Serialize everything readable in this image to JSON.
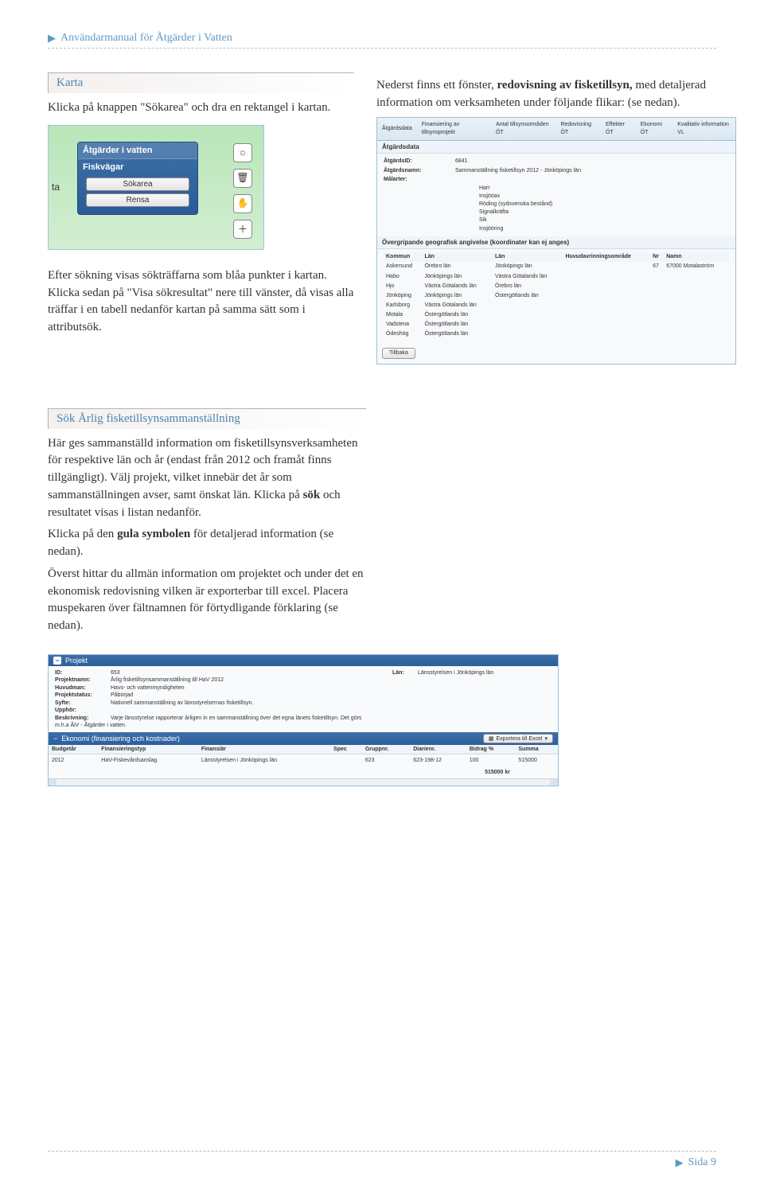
{
  "header": {
    "title": "Användarmanual för Åtgärder i Vatten"
  },
  "section1": {
    "heading": "Karta",
    "para": "Klicka på knappen \"Sökarea\" och dra en rektangel i kartan."
  },
  "map_popup": {
    "title": "Åtgärder i vatten",
    "subtitle": "Fiskvägar",
    "btn1": "Sökarea",
    "btn2": "Rensa"
  },
  "right1": {
    "p1a": "Nederst finns ett fönster, ",
    "p1b": "redovisning av fisketillsyn,",
    "p1c": " med detaljerad information om verksamheten under följande flikar: (se nedan)."
  },
  "atgards": {
    "tabs": [
      "Åtgärdsdata",
      "Finansiering av tillsynsprojekt",
      "Antal tillsynsområden ÖT",
      "Redovisning ÖT",
      "Effekter ÖT",
      "Ekonomi ÖT",
      "Kvalitativ information VL"
    ],
    "heading": "Åtgärdsdata",
    "id_label": "ÅtgärdsID:",
    "id_value": "6841",
    "name_label": "Åtgärdsnamn:",
    "name_value": "Sammanställning fisketillsyn 2012 - Jönköpings län",
    "malarter_label": "Målarter:",
    "malarter": [
      "Harr",
      "Insjööax",
      "Röding (sydsvenska bestånd)",
      "Signalkräfta",
      "Sik",
      "Insjööring"
    ],
    "geo_heading": "Övergripande geografisk angivelse (koordinater kan ej anges)",
    "cols": [
      "Kommun",
      "Län",
      "Län",
      "Huvudavrinningsområde",
      "Nr",
      "Namn"
    ],
    "rows": [
      [
        "Askersund",
        "Örebro län",
        "Jönköpings län",
        "",
        "67",
        "67000 Motalaström"
      ],
      [
        "Habo",
        "Jönköpings län",
        "Västra Götalands län",
        "",
        "",
        ""
      ],
      [
        "Hjo",
        "Västra Götalands län",
        "Örebro län",
        "",
        "",
        ""
      ],
      [
        "Jönköping",
        "Jönköpings län",
        "Östergötlands län",
        "",
        "",
        ""
      ],
      [
        "Karlsborg",
        "Västra Götalands län",
        "",
        "",
        "",
        ""
      ],
      [
        "Motala",
        "Östergötlands län",
        "",
        "",
        "",
        ""
      ],
      [
        "Vadstena",
        "Östergötlands län",
        "",
        "",
        "",
        ""
      ],
      [
        "Ödeshög",
        "Östergötlands län",
        "",
        "",
        "",
        ""
      ]
    ],
    "back": "Tillbaka"
  },
  "left2": {
    "para": "Efter sökning visas sökträffarna som blåa punkter i kartan. Klicka sedan på \"Visa sökresultat\" nere till vänster, då visas alla träffar i en tabell nedanför kartan på samma sätt som i attributsök."
  },
  "section2": {
    "heading": "Sök Årlig fisketillsynsammanställning",
    "p1a": "Här ges sammanställd information om fisketillsynsverksamheten för respektive län och år (endast från 2012 och framåt finns tillgängligt). Välj projekt, vilket innebär det år som sammanställningen avser, samt önskat län. Klicka på ",
    "p1b": "sök",
    "p1c": " och resultatet visas i listan nedanför.",
    "p2a": "Klicka på den ",
    "p2b": "gula symbolen",
    "p2c": " för detaljerad information (se nedan).",
    "p3": "Överst hittar du allmän information om projektet och under det en ekonomisk redovisning vilken är exporterbar till excel. Placera muspekaren över fältnamnen för förtydligande förklaring (se nedan)."
  },
  "projekt": {
    "title": "Projekt",
    "kv": {
      "id_l": "ID:",
      "id_v": "653",
      "projnamn_l": "Projektnamn:",
      "projnamn_v": "Årlig fisketillsynsammanställning till HaV 2012",
      "huvudman_l": "Huvudman:",
      "huvudman_v": "Havs- och vattenmyndigheten",
      "status_l": "Projektstatus:",
      "status_v": "Påbörjad",
      "syfte_l": "Syfte:",
      "syfte_v": "Nationell sammanställning av länsstyrelsernas fisketillsyn.",
      "upphor_l": "Upphör:",
      "upphor_v": "",
      "beskr_l": "Beskrivning:",
      "beskr_v": "Varje länsstyrelse rapporterar årligen in en sammanställning över det egna länets fisketillsyn. Det görs m.h.a ÅiV - Åtgärder i vatten.",
      "lan_l": "Län:",
      "lan_v": "Länsstyrelsen i Jönköpings län"
    },
    "econ_title": "Ekonomi (finansiering och kostnader)",
    "export": "Exportera till Excel",
    "econ_cols": [
      "Budgetår",
      "Finansieringstyp",
      "Finansiär",
      "Spec",
      "Gruppnr.",
      "Diarienr.",
      "Bidrag %",
      "Summa"
    ],
    "econ_row": [
      "2012",
      "HaV-Fiskevårdsanslag",
      "Länsstyrelsen i Jönköpings län",
      "",
      "623",
      "623-198-12",
      "100",
      "515000"
    ],
    "sum": "515000 kr"
  },
  "footer": {
    "label": "Sida 9"
  }
}
